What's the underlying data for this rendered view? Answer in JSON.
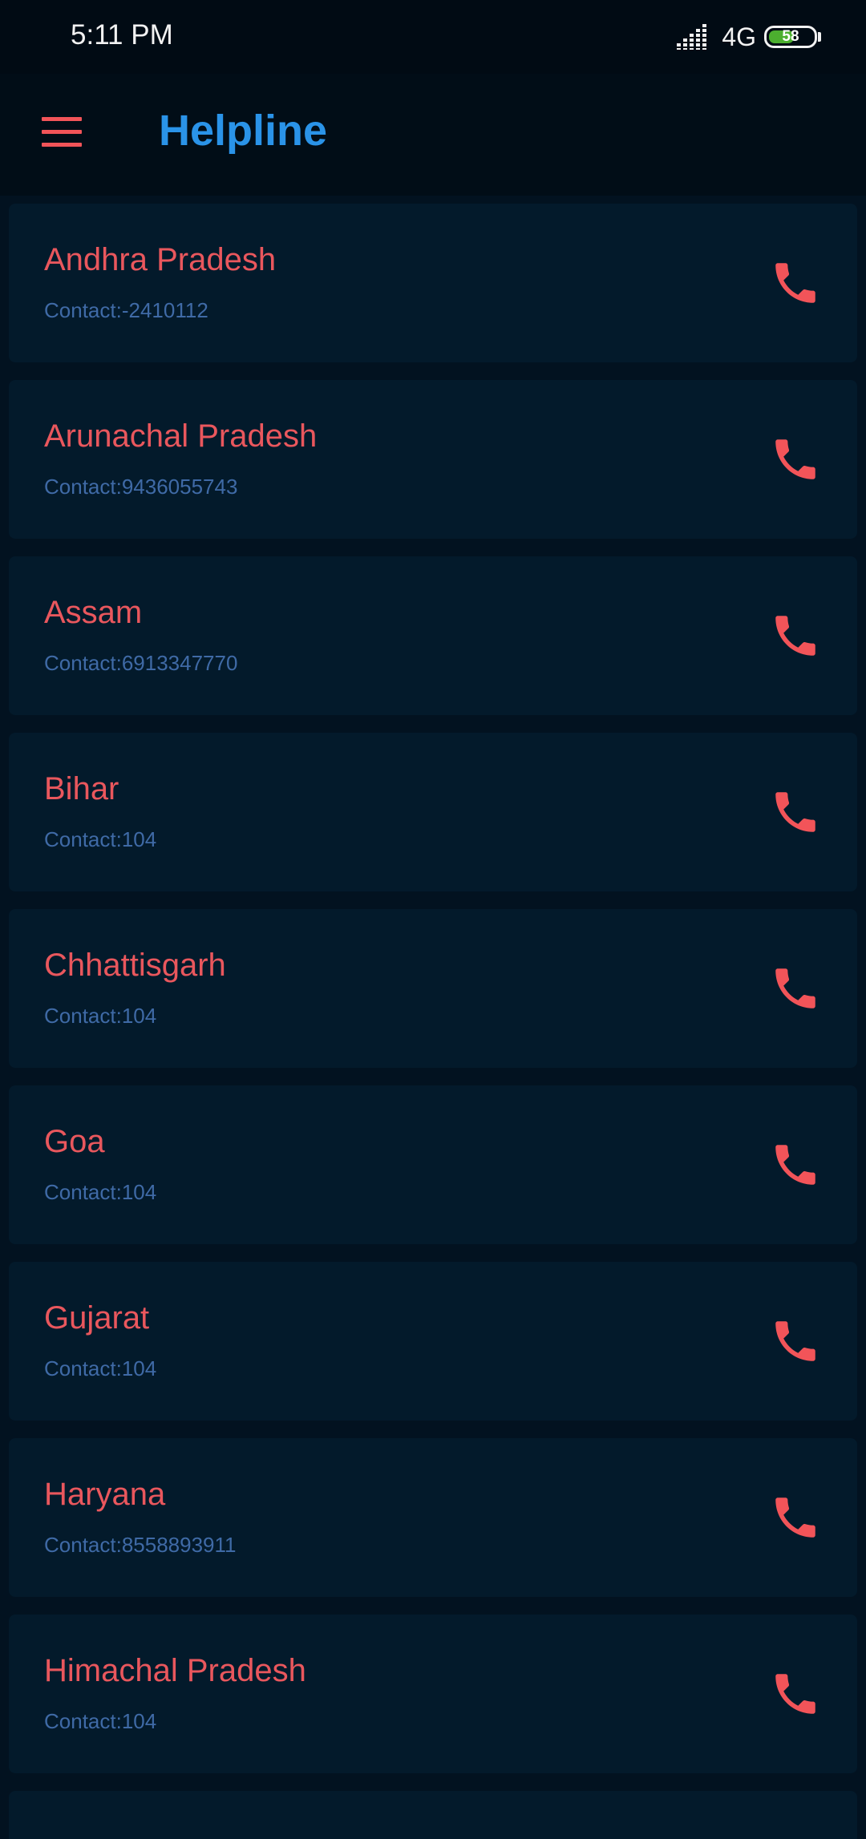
{
  "status_bar": {
    "time": "5:11 PM",
    "network": "4G",
    "battery_level": "58",
    "battery_fraction": 0.58,
    "signal_icon": "signal-bars-icon",
    "battery_color": "#4caf2f"
  },
  "app_bar": {
    "title": "Helpline",
    "menu_icon": "hamburger-menu-icon",
    "title_color": "#2a93e8"
  },
  "helplines": [
    {
      "state": "Andhra Pradesh",
      "contact": "Contact:-2410112"
    },
    {
      "state": "Arunachal Pradesh",
      "contact": "Contact:9436055743"
    },
    {
      "state": "Assam",
      "contact": "Contact:6913347770"
    },
    {
      "state": "Bihar",
      "contact": "Contact:104"
    },
    {
      "state": "Chhattisgarh",
      "contact": "Contact:104"
    },
    {
      "state": "Goa",
      "contact": "Contact:104"
    },
    {
      "state": "Gujarat",
      "contact": "Contact:104"
    },
    {
      "state": "Haryana",
      "contact": "Contact:8558893911"
    },
    {
      "state": "Himachal Pradesh",
      "contact": "Contact:104"
    }
  ],
  "colors": {
    "background": "#021220",
    "card": "#031a2b",
    "state_text": "#e9575d",
    "contact_text": "#3f6aa6",
    "call_icon": "#f25459"
  }
}
